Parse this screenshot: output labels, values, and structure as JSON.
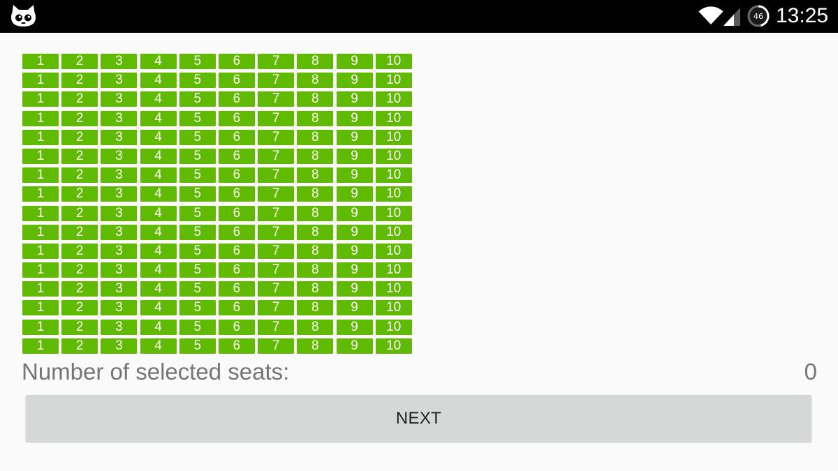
{
  "status_bar": {
    "left_icon": "cyanogenmod-mascot-icon",
    "wifi_icon": "wifi-icon",
    "signal_icon": "cell-signal-icon",
    "battery_icon": "battery-circle-icon",
    "battery_level": "46",
    "time": "13:25"
  },
  "seat_grid": {
    "rows": [
      [
        "1",
        "2",
        "3",
        "4",
        "5",
        "6",
        "7",
        "8",
        "9",
        "10"
      ],
      [
        "1",
        "2",
        "3",
        "4",
        "5",
        "6",
        "7",
        "8",
        "9",
        "10"
      ],
      [
        "1",
        "2",
        "3",
        "4",
        "5",
        "6",
        "7",
        "8",
        "9",
        "10"
      ],
      [
        "1",
        "2",
        "3",
        "4",
        "5",
        "6",
        "7",
        "8",
        "9",
        "10"
      ],
      [
        "1",
        "2",
        "3",
        "4",
        "5",
        "6",
        "7",
        "8",
        "9",
        "10"
      ],
      [
        "1",
        "2",
        "3",
        "4",
        "5",
        "6",
        "7",
        "8",
        "9",
        "10"
      ],
      [
        "1",
        "2",
        "3",
        "4",
        "5",
        "6",
        "7",
        "8",
        "9",
        "10"
      ],
      [
        "1",
        "2",
        "3",
        "4",
        "5",
        "6",
        "7",
        "8",
        "9",
        "10"
      ],
      [
        "1",
        "2",
        "3",
        "4",
        "5",
        "6",
        "7",
        "8",
        "9",
        "10"
      ],
      [
        "1",
        "2",
        "3",
        "4",
        "5",
        "6",
        "7",
        "8",
        "9",
        "10"
      ],
      [
        "1",
        "2",
        "3",
        "4",
        "5",
        "6",
        "7",
        "8",
        "9",
        "10"
      ],
      [
        "1",
        "2",
        "3",
        "4",
        "5",
        "6",
        "7",
        "8",
        "9",
        "10"
      ],
      [
        "1",
        "2",
        "3",
        "4",
        "5",
        "6",
        "7",
        "8",
        "9",
        "10"
      ],
      [
        "1",
        "2",
        "3",
        "4",
        "5",
        "6",
        "7",
        "8",
        "9",
        "10"
      ],
      [
        "1",
        "2",
        "3",
        "4",
        "5",
        "6",
        "7",
        "8",
        "9",
        "10"
      ],
      [
        "1",
        "2",
        "3",
        "4",
        "5",
        "6",
        "7",
        "8",
        "9",
        "10"
      ]
    ]
  },
  "selection": {
    "label": "Number of selected seats:",
    "count": "0"
  },
  "next_button": {
    "label": "NEXT"
  },
  "colors": {
    "status_bar_background": "#000000",
    "page_background": "#fafafa",
    "seat_available": "#5fba00",
    "seat_text": "#ffffff",
    "label_text": "#757575",
    "button_background": "#d6d7d7",
    "button_text": "#212121"
  }
}
